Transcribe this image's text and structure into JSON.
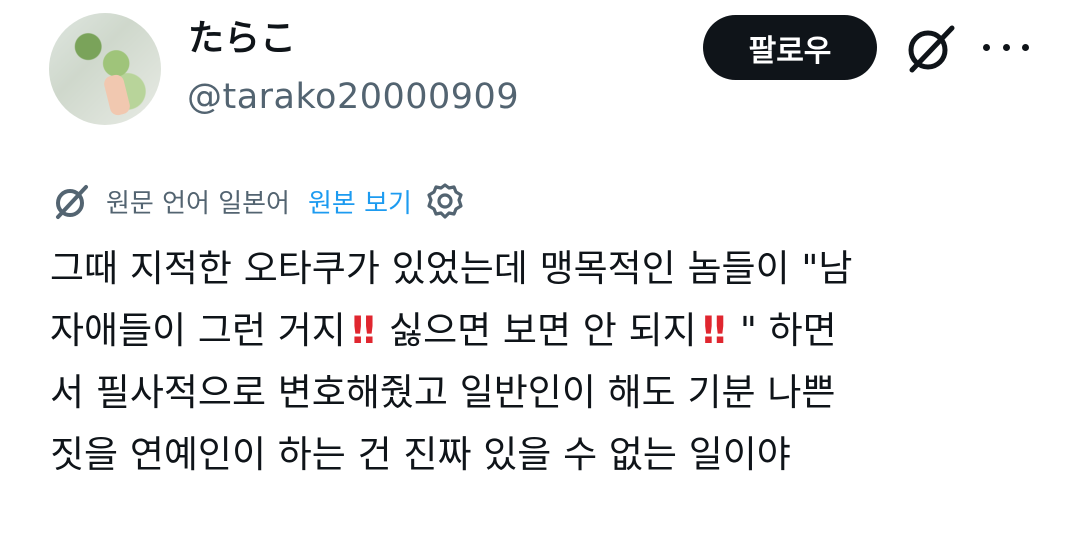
{
  "user": {
    "display_name": "たらこ",
    "handle": "@tarako20000909"
  },
  "actions": {
    "follow_label": "팔로우"
  },
  "translation": {
    "note": "원문 언어 일본어",
    "show_original_label": "원본 보기"
  },
  "tweet": {
    "line1": "그때 지적한 오타쿠가 있었는데 맹목적인 놈들이 \"남",
    "line2_a": "자애들이 그런 거지",
    "line2_emoji": "‼",
    "line2_b": "싫으면 보면 안 되지",
    "line2_c": "\" 하면",
    "line3": "서 필사적으로 변호해줬고 일반인이 해도 기분 나쁜",
    "line4": "짓을 연예인이 하는 건 진짜 있을 수 없는 일이야"
  },
  "icons": {
    "grok": "grok-icon",
    "more": "more-icon",
    "translate": "grok-icon",
    "settings": "gear-icon"
  },
  "colors": {
    "accent": "#1d9bf0",
    "secondary_text": "#536471",
    "follow_bg": "#0f1419",
    "emoji_red": "#e0262f"
  }
}
